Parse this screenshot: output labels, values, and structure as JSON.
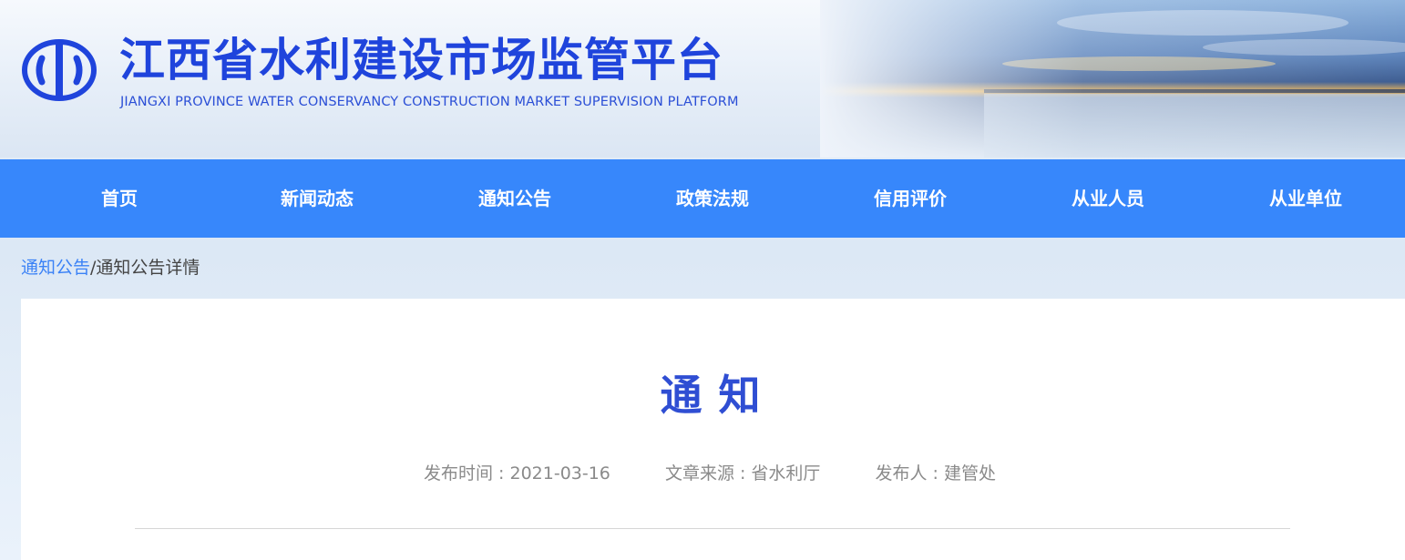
{
  "header": {
    "title": "江西省水利建设市场监管平台",
    "subtitle": "JIANGXI PROVINCE WATER CONSERVANCY CONSTRUCTION MARKET SUPERVISION PLATFORM",
    "logo_icon": "water-conservancy-emblem-icon",
    "brand_color": "#1f44dc"
  },
  "nav": {
    "color": "#3787fb",
    "items": [
      {
        "label": "首页"
      },
      {
        "label": "新闻动态"
      },
      {
        "label": "通知公告"
      },
      {
        "label": "政策法规"
      },
      {
        "label": "信用评价"
      },
      {
        "label": "从业人员"
      },
      {
        "label": "从业单位"
      }
    ]
  },
  "breadcrumb": {
    "parent": "通知公告",
    "separator": "/",
    "current": "通知公告详情"
  },
  "article": {
    "title": "通知",
    "meta": {
      "date_label": "发布时间 : 2021-03-16",
      "source_label": "文章来源 : 省水利厅",
      "publisher_label": "发布人 : 建管处"
    }
  }
}
